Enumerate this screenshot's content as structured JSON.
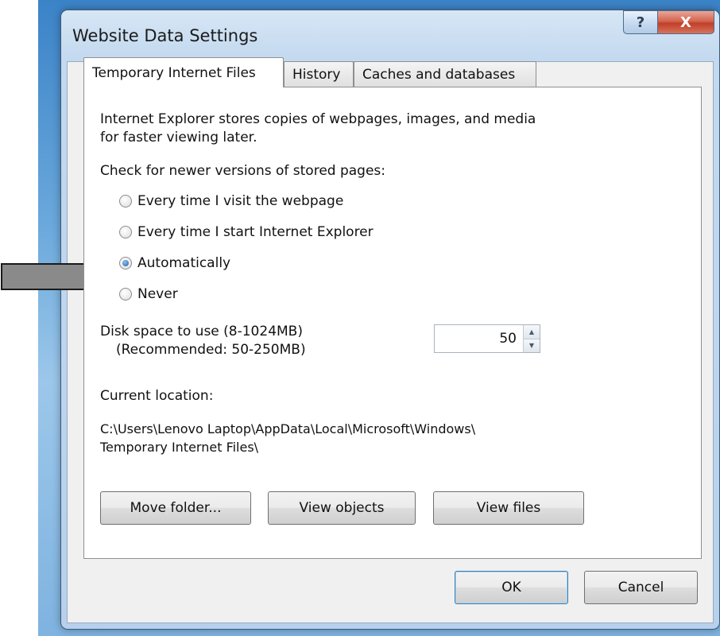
{
  "window": {
    "title": "Website Data Settings",
    "help_glyph": "?",
    "close_glyph": "X"
  },
  "tabs": [
    {
      "label": "Temporary Internet Files",
      "active": true
    },
    {
      "label": "History",
      "active": false
    },
    {
      "label": "Caches and databases",
      "active": false
    }
  ],
  "panel": {
    "desc_line1": "Internet Explorer stores copies of webpages, images, and media",
    "desc_line2": "for faster viewing later.",
    "check_label": "Check for newer versions of stored pages:",
    "options": [
      {
        "label": "Every time I visit the webpage",
        "checked": false
      },
      {
        "label": "Every time I start Internet Explorer",
        "checked": false
      },
      {
        "label": "Automatically",
        "checked": true
      },
      {
        "label": "Never",
        "checked": false
      }
    ],
    "disk_label": "Disk space to use (8-1024MB)",
    "disk_recommended": "(Recommended: 50-250MB)",
    "disk_value": "50",
    "location_label": "Current location:",
    "location_line1": "C:\\Users\\Lenovo Laptop\\AppData\\Local\\Microsoft\\Windows\\",
    "location_line2": "Temporary Internet Files\\",
    "buttons": {
      "move": "Move folder...",
      "view_objects": "View objects",
      "view_files": "View files"
    }
  },
  "footer": {
    "ok": "OK",
    "cancel": "Cancel"
  },
  "colors": {
    "arrow": "#8a8a8a",
    "selected_radio": "#1d5fa8"
  }
}
